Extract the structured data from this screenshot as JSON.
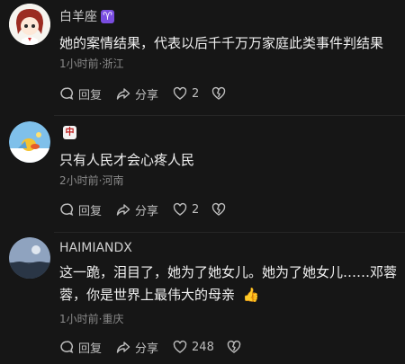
{
  "comments": [
    {
      "username": "白羊座",
      "badge": "♈",
      "text_lines": [
        "她的案情结果，代表以后千千万万家庭此类事件判结果"
      ],
      "meta": "1小时前·浙江",
      "actions": {
        "reply": "回复",
        "share": "分享",
        "likes": "2"
      }
    },
    {
      "username": "",
      "badge": "中",
      "text_lines": [
        "只有人民才会心疼人民"
      ],
      "meta": "2小时前·河南",
      "actions": {
        "reply": "回复",
        "share": "分享",
        "likes": "2"
      }
    },
    {
      "username": "HAIMIANDX",
      "badge": "",
      "text_lines": [
        "这一跪，泪目了，她为了她女儿。她为了她女儿……邓蓉",
        "蓉，你是世界上最伟大的母亲"
      ],
      "emoji": "👍",
      "meta": "1小时前·重庆",
      "actions": {
        "reply": "回复",
        "share": "分享",
        "likes": "248"
      }
    }
  ],
  "icons": {
    "reply": "comment-bubble-icon",
    "share": "share-arrow-icon",
    "like": "heart-icon",
    "dislike": "broken-heart-icon"
  }
}
